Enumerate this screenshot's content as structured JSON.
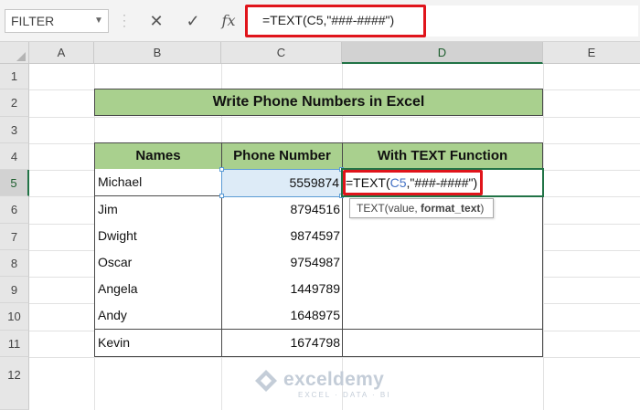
{
  "formula_bar": {
    "name_box": "FILTER",
    "cancel_icon": "✕",
    "enter_icon": "✓",
    "fx_label": "fx",
    "formula": "=TEXT(C5,\"###-####\")"
  },
  "columns": [
    "A",
    "B",
    "C",
    "D",
    "E"
  ],
  "rows": [
    "1",
    "2",
    "3",
    "4",
    "5",
    "6",
    "7",
    "8",
    "9",
    "10",
    "11",
    "12"
  ],
  "active_cell": "D5",
  "table": {
    "title": "Write Phone Numbers in Excel",
    "headers": [
      "Names",
      "Phone Number",
      "With TEXT Function"
    ],
    "data": [
      {
        "name": "Michael",
        "phone": "5559874"
      },
      {
        "name": "Jim",
        "phone": "8794516"
      },
      {
        "name": "Dwight",
        "phone": "9874597"
      },
      {
        "name": "Oscar",
        "phone": "9754987"
      },
      {
        "name": "Angela",
        "phone": "1449789"
      },
      {
        "name": "Andy",
        "phone": "1648975"
      },
      {
        "name": "Kevin",
        "phone": "1674798"
      }
    ]
  },
  "editing": {
    "prefix": "=TEXT(",
    "ref": "C5",
    "suffix": ",\"###-####\")",
    "tooltip_func": "TEXT(value, ",
    "tooltip_arg": "format_text",
    "tooltip_close": ")"
  },
  "watermark": {
    "name": "exceldemy",
    "tagline": "EXCEL · DATA · BI"
  },
  "colors": {
    "header_fill": "#a9d08e",
    "highlight_red": "#e0141b",
    "excel_green": "#217346",
    "selection_blue": "#5b9bd5"
  }
}
